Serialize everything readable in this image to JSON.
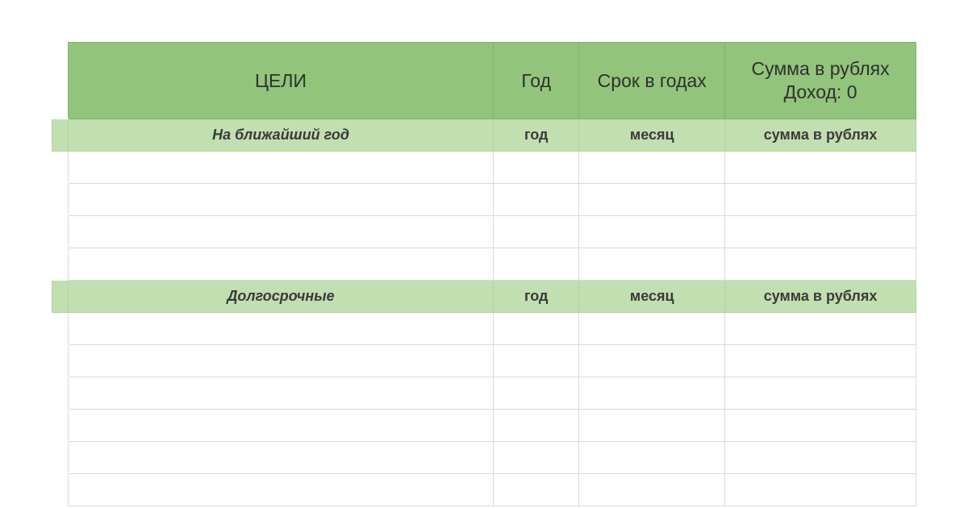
{
  "header": {
    "goals": "ЦЕЛИ",
    "year": "Год",
    "term": "Срок в годах",
    "sum_line1": "Сумма в рублях",
    "sum_line2": "Доход: 0"
  },
  "sections": [
    {
      "title": "На ближайший год",
      "year": "год",
      "term": "месяц",
      "sum": "сумма в рублях",
      "empty_rows": 4
    },
    {
      "title": "Долгосрочные",
      "year": "год",
      "term": "месяц",
      "sum": "сумма в рублях",
      "empty_rows": 6
    }
  ]
}
